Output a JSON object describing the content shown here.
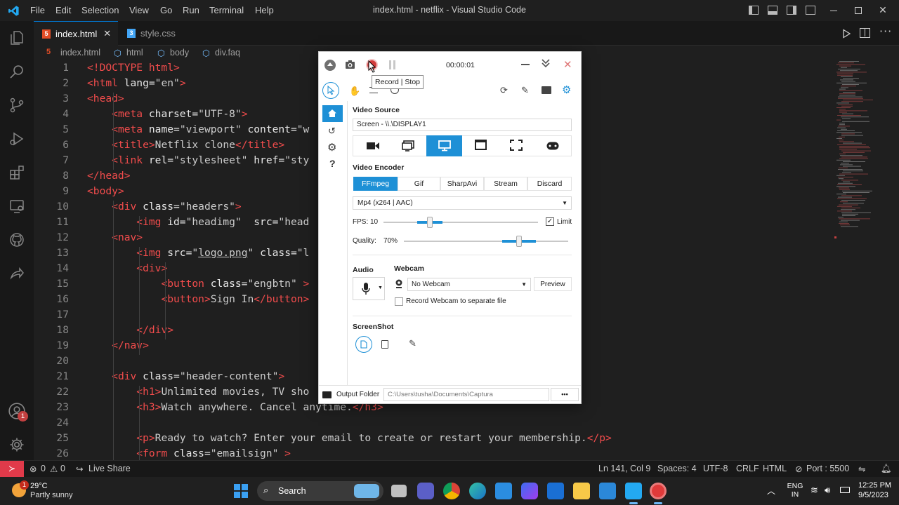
{
  "titlebar": {
    "menus": [
      "File",
      "Edit",
      "Selection",
      "View",
      "Go",
      "Run",
      "Terminal",
      "Help"
    ],
    "title": "index.html - netflix - Visual Studio Code"
  },
  "tabs": [
    {
      "icon": "5",
      "label": "index.html",
      "color": "#e44d26"
    },
    {
      "icon": "3",
      "label": "style.css",
      "color": "#42a5f5"
    }
  ],
  "breadcrumb": [
    "index.html",
    "html",
    "body",
    "div.faq"
  ],
  "editor": {
    "lines": [
      [
        [
          "t",
          "<!DOCTYPE html>"
        ]
      ],
      [
        [
          "t",
          "<html "
        ],
        [
          "a",
          "lang="
        ],
        [
          "s",
          "\"en\""
        ],
        [
          "t",
          ">"
        ]
      ],
      [
        [
          "t",
          "<head>"
        ]
      ],
      [
        [
          "tx",
          "    "
        ],
        [
          "t",
          "<meta "
        ],
        [
          "a",
          "charset="
        ],
        [
          "s",
          "\"UTF-8\""
        ],
        [
          "t",
          ">"
        ]
      ],
      [
        [
          "tx",
          "    "
        ],
        [
          "t",
          "<meta "
        ],
        [
          "a",
          "name="
        ],
        [
          "s",
          "\"viewport\" "
        ],
        [
          "a",
          "content="
        ],
        [
          "s",
          "\"w"
        ]
      ],
      [
        [
          "tx",
          "    "
        ],
        [
          "t",
          "<title>"
        ],
        [
          "tx",
          "Netflix clone"
        ],
        [
          "t",
          "</title>"
        ]
      ],
      [
        [
          "tx",
          "    "
        ],
        [
          "t",
          "<link "
        ],
        [
          "a",
          "rel="
        ],
        [
          "s",
          "\"stylesheet\" "
        ],
        [
          "a",
          "href="
        ],
        [
          "s",
          "\"sty"
        ]
      ],
      [
        [
          "t",
          "</head>"
        ]
      ],
      [
        [
          "t",
          "<body>"
        ]
      ],
      [
        [
          "tx",
          "    "
        ],
        [
          "t",
          "<div "
        ],
        [
          "a",
          "class="
        ],
        [
          "s",
          "\"headers\""
        ],
        [
          "t",
          ">"
        ]
      ],
      [
        [
          "tx",
          "        "
        ],
        [
          "t",
          "<img "
        ],
        [
          "a",
          "id="
        ],
        [
          "s",
          "\"headimg\"  "
        ],
        [
          "a",
          "src="
        ],
        [
          "s",
          "\"head"
        ]
      ],
      [
        [
          "tx",
          "    "
        ],
        [
          "t",
          "<nav>"
        ]
      ],
      [
        [
          "tx",
          "        "
        ],
        [
          "t",
          "<img "
        ],
        [
          "a",
          "src="
        ],
        [
          "s",
          "\""
        ],
        [
          "lk",
          "logo.png"
        ],
        [
          "s",
          "\" "
        ],
        [
          "a",
          "class="
        ],
        [
          "s",
          "\"l"
        ]
      ],
      [
        [
          "tx",
          "        "
        ],
        [
          "t",
          "<div>"
        ]
      ],
      [
        [
          "tx",
          "            "
        ],
        [
          "t",
          "<button "
        ],
        [
          "a",
          "class="
        ],
        [
          "s",
          "\"engbtn\" "
        ],
        [
          "t",
          ">"
        ],
        [
          "tx",
          "                              "
        ],
        [
          "t",
          "</button>"
        ]
      ],
      [
        [
          "tx",
          "            "
        ],
        [
          "t",
          "<button>"
        ],
        [
          "tx",
          "Sign In"
        ],
        [
          "t",
          "</button>"
        ]
      ],
      [
        [
          "tx",
          ""
        ]
      ],
      [
        [
          "tx",
          "        "
        ],
        [
          "t",
          "</div>"
        ]
      ],
      [
        [
          "tx",
          "    "
        ],
        [
          "t",
          "</nav>"
        ]
      ],
      [
        [
          "tx",
          ""
        ]
      ],
      [
        [
          "tx",
          "    "
        ],
        [
          "t",
          "<div "
        ],
        [
          "a",
          "class="
        ],
        [
          "s",
          "\"header-content\""
        ],
        [
          "t",
          ">"
        ]
      ],
      [
        [
          "tx",
          "        "
        ],
        [
          "t",
          "<h1>"
        ],
        [
          "tx",
          "Unlimited movies, TV sho"
        ]
      ],
      [
        [
          "tx",
          "        "
        ],
        [
          "t",
          "<h3>"
        ],
        [
          "tx",
          "Watch anywhere. Cancel anytime."
        ],
        [
          "t",
          "</h3>"
        ]
      ],
      [
        [
          "tx",
          ""
        ]
      ],
      [
        [
          "tx",
          "        "
        ],
        [
          "t",
          "<p>"
        ],
        [
          "tx",
          "Ready to watch? Enter your email to create or restart your membership."
        ],
        [
          "t",
          "</p>"
        ]
      ],
      [
        [
          "tx",
          "        "
        ],
        [
          "t",
          "<form "
        ],
        [
          "a",
          "class="
        ],
        [
          "s",
          "\"emailsign\" "
        ],
        [
          "t",
          ">"
        ]
      ]
    ],
    "first_line": 1
  },
  "status": {
    "errors": "0",
    "warnings": "0",
    "live_share": "Live Share",
    "position": "Ln 141, Col 9",
    "spaces": "Spaces: 4",
    "encoding": "UTF-8",
    "eol": "CRLF",
    "language": "HTML",
    "port": "Port : 5500"
  },
  "taskbar": {
    "weather_temp": "29°C",
    "weather_desc": "Partly sunny",
    "weather_badge": "1",
    "search": "Search",
    "lang": "ENG",
    "lang_region": "IN",
    "time": "12:25 PM",
    "date": "9/5/2023",
    "account_badge": "1"
  },
  "captura": {
    "timer": "00:00:01",
    "tooltip": "Record | Stop",
    "video_source_heading": "Video Source",
    "video_source_value": "Screen  -  \\\\.\\DISPLAY1",
    "video_encoder_heading": "Video Encoder",
    "encoder_tabs": [
      "FFmpeg",
      "Gif",
      "SharpAvi",
      "Stream",
      "Discard"
    ],
    "encoder_selected": "FFmpeg",
    "codec_value": "Mp4 (x264 | AAC)",
    "fps_label": "FPS:",
    "fps_value": "10",
    "fps_fraction": 0.3,
    "limit_label": "Limit",
    "quality_label": "Quality:",
    "quality_value": "70%",
    "quality_fraction": 0.7,
    "audio_heading": "Audio",
    "webcam_heading": "Webcam",
    "webcam_value": "No Webcam",
    "preview_label": "Preview",
    "webcam_separate_label": "Record Webcam to separate file",
    "screenshot_heading": "ScreenShot",
    "output_folder_label": "Output Folder",
    "output_folder_value": "C:\\Users\\tusha\\Documents\\Captura",
    "more_label": "•••",
    "help_label": "?",
    "accent": "#1e90d6"
  }
}
